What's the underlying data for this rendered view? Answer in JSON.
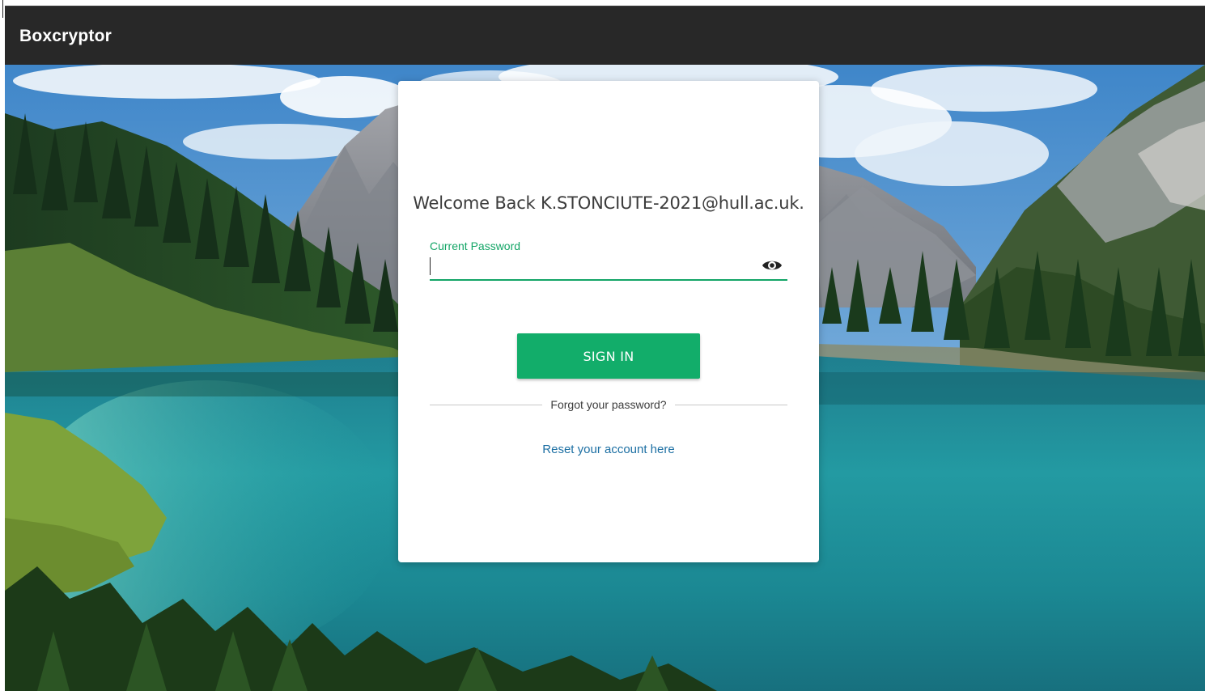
{
  "app": {
    "title": "Boxcryptor"
  },
  "login": {
    "welcome_text": "Welcome Back K.STONCIUTE-2021@hull.ac.uk.",
    "password_label": "Current Password",
    "password_value": "",
    "show_password_icon": "eye-icon",
    "sign_in_label": "SIGN IN",
    "forgot_text": "Forgot your password?",
    "reset_link_text": "Reset your account here"
  },
  "colors": {
    "titlebar": "#282828",
    "accent_green": "#12ad6a",
    "link_blue": "#1c6fa3"
  }
}
